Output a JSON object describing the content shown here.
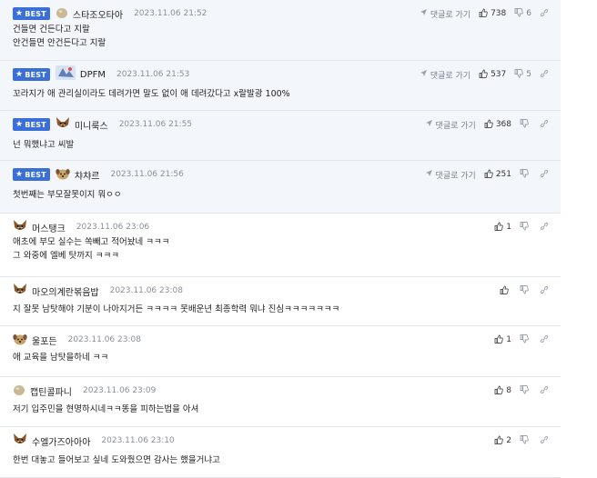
{
  "comments": [
    {
      "best": true,
      "badge": "BEST",
      "nick": "스타조오타아",
      "date": "2023.11.06 21:52",
      "lines": [
        "건들면 건든다고 지랄",
        "안건들면 안건든다고 지랄"
      ],
      "reply": "댓글로 가기",
      "up": "738",
      "down": "6",
      "avatar": "egg-icon"
    },
    {
      "best": true,
      "badge": "BEST",
      "nick": "DPFM",
      "date": "2023.11.06 21:53",
      "lines": [
        "꼬라지가 애 관리실이라도 데려가면 말도 없이 애 데려갔다고 x랄발광 100%"
      ],
      "reply": "댓글로 가기",
      "up": "537",
      "down": "5",
      "avatar": "dpfm-icon"
    },
    {
      "best": true,
      "badge": "BEST",
      "nick": "미니룩스",
      "date": "2023.11.06 21:55",
      "lines": [
        "넌 뭐했냐고 씨발"
      ],
      "reply": "댓글로 가기",
      "up": "368",
      "down": "",
      "avatar": "fox-icon"
    },
    {
      "best": true,
      "badge": "BEST",
      "nick": "챠챠르",
      "date": "2023.11.06 21:56",
      "lines": [
        "첫번째는 부모잘못이지 뭐ㅇㅇ"
      ],
      "reply": "댓글로 가기",
      "up": "251",
      "down": "",
      "avatar": "dog-icon"
    },
    {
      "best": false,
      "nick": "머스탱크",
      "date": "2023.11.06 23:06",
      "lines": [
        "애초에 부모 실수는 쏙빼고 적어놨네 ㅋㅋㅋ",
        "그 와중에 엘베 탓까지 ㅋㅋㅋ"
      ],
      "up": "1",
      "avatar": "fox-icon"
    },
    {
      "best": false,
      "nick": "마오의계란볶음밥",
      "date": "2023.11.06 23:08",
      "lines": [
        "지 잘못 남탓해야 기분이 나아지거든 ㅋㅋㅋㅋ 못배운년 최종학력 뭐냐 진심ㅋㅋㅋㅋㅋㅋㅋ"
      ],
      "up": "",
      "avatar": "fox-icon"
    },
    {
      "best": false,
      "nick": "울포든",
      "date": "2023.11.06 23:08",
      "lines": [
        "애 교육을 남탓을하네 ㅋㅋ"
      ],
      "up": "1",
      "avatar": "dog-icon"
    },
    {
      "best": false,
      "nick": "캡틴콜파니",
      "date": "2023.11.06 23:09",
      "lines": [
        "저기 입주민을 현명하시네ㅋㅋ똥을 피하는법을 아셔"
      ],
      "up": "8",
      "avatar": "egg-icon"
    },
    {
      "best": false,
      "nick": "수엘가즈아아아",
      "date": "2023.11.06 23:10",
      "lines": [
        "한번 대놓고 들어보고 싶네 도와줬으면 감사는 했을거냐고"
      ],
      "up": "2",
      "avatar": "fox-icon"
    }
  ]
}
